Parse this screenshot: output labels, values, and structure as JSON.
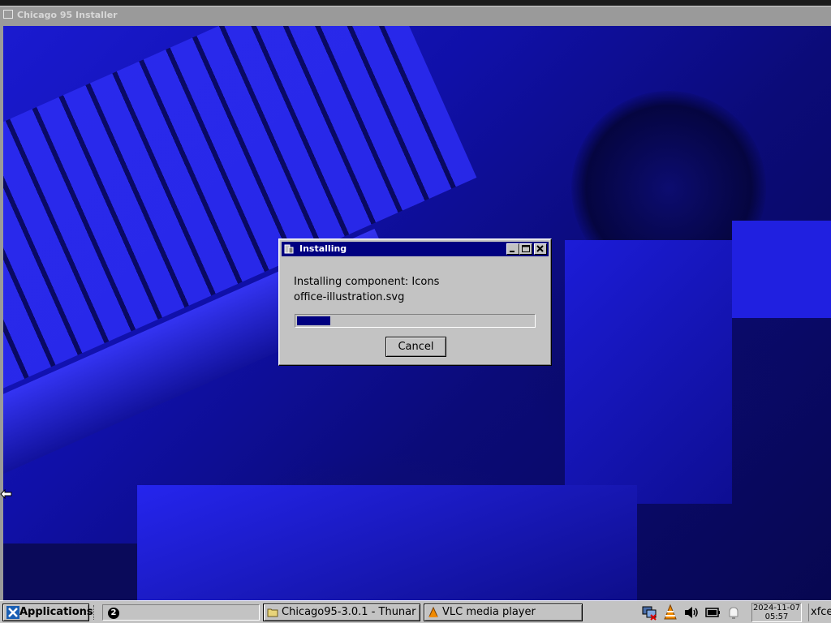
{
  "background_window": {
    "title": "Chicago 95 Installer"
  },
  "dialog": {
    "title": "Installing",
    "status_line": "Installing component: Icons",
    "file_line": "office-illustration.svg",
    "progress": 0.14,
    "cancel_label": "Cancel",
    "title_buttons": [
      "minimize",
      "maximize",
      "close"
    ]
  },
  "taskbar": {
    "applications_label": "Applications",
    "workspace_number": "2",
    "tasks": [
      {
        "label": "Chicago95-3.0.1 - Thunar",
        "icon": "folder-icon"
      },
      {
        "label": "VLC media player",
        "icon": "vlc-icon"
      }
    ],
    "tray_icons": [
      "network-icon",
      "vlc-tray-icon",
      "volume-icon",
      "battery-icon",
      "notification-icon"
    ],
    "clock": {
      "date": "2024-11-07",
      "time": "05:57"
    },
    "user_label": "xfce"
  },
  "colors": {
    "titlebar": "#000080",
    "face": "#c3c3c3",
    "progress_fill": "#000080",
    "wallpaper": "#1414b8"
  }
}
